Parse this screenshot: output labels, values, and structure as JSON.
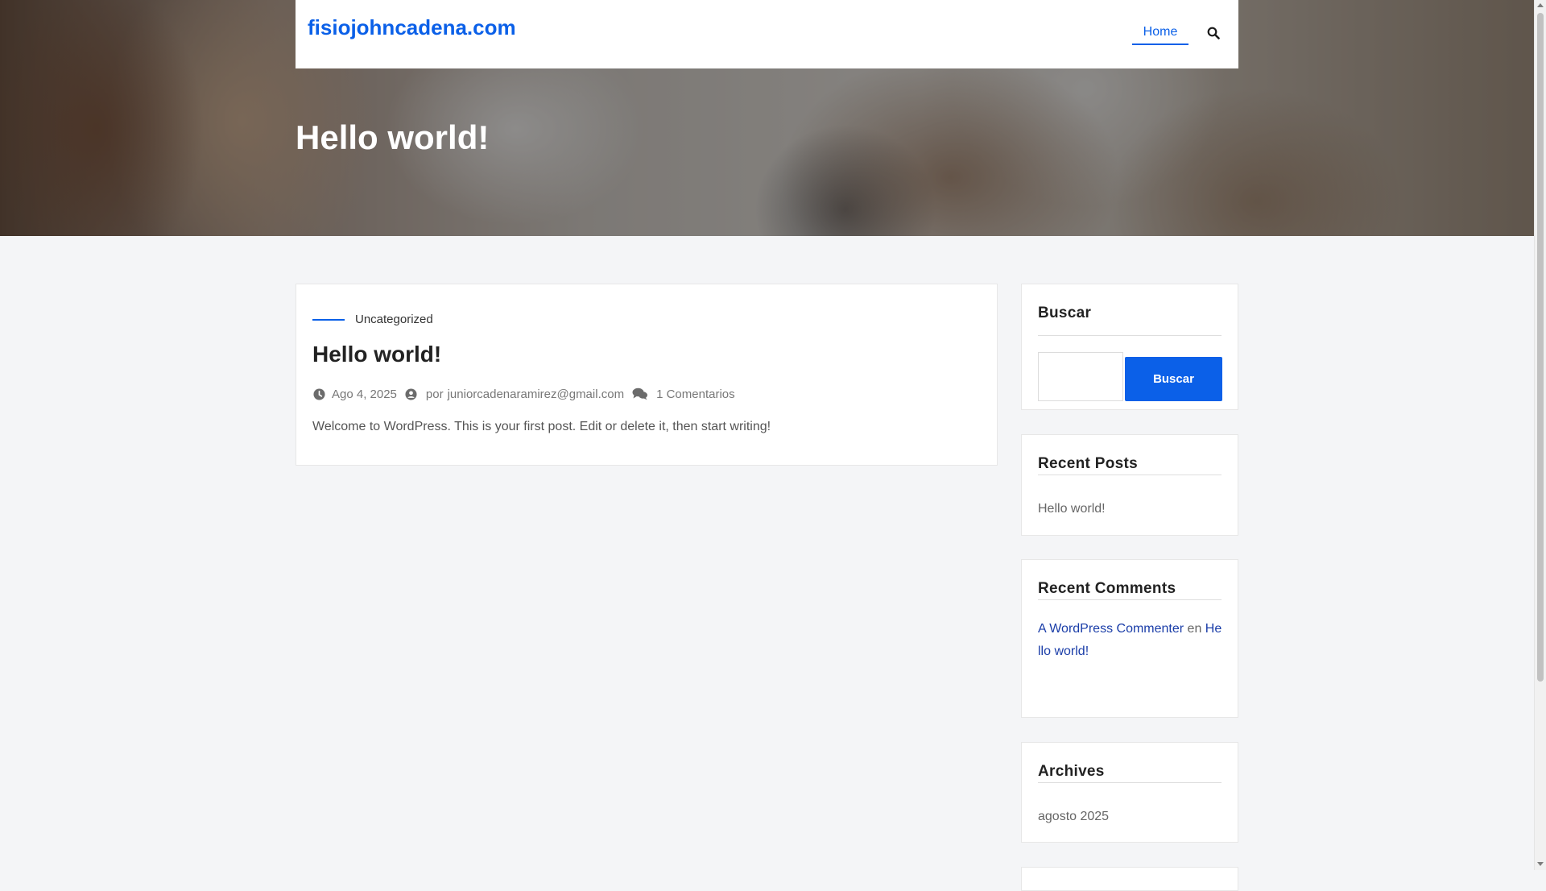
{
  "site": {
    "title": "fisiojohncadena.com",
    "nav_home": "Home",
    "accent_color": "#0b60e8"
  },
  "hero": {
    "title": "Hello world!"
  },
  "post": {
    "category": "Uncategorized",
    "title": "Hello world!",
    "date": "Ago 4, 2025",
    "by_label": "por",
    "author": "juniorcadenaramirez@gmail.com",
    "comments": "1 Comentarios",
    "excerpt": "Welcome to WordPress. This is your first post. Edit or delete it, then start writing!"
  },
  "sidebar": {
    "search": {
      "title": "Buscar",
      "input_value": "",
      "button_label": "Buscar"
    },
    "recent_posts": {
      "title": "Recent Posts",
      "items": [
        "Hello world!"
      ]
    },
    "recent_comments": {
      "title": "Recent Comments",
      "author": "A WordPress Commenter",
      "connector": "en",
      "post": "Hello world!"
    },
    "archives": {
      "title": "Archives",
      "items": [
        "agosto 2025"
      ]
    }
  },
  "icons": {
    "search": "search-icon",
    "clock": "clock-icon",
    "user": "user-icon",
    "comments": "comments-icon"
  }
}
